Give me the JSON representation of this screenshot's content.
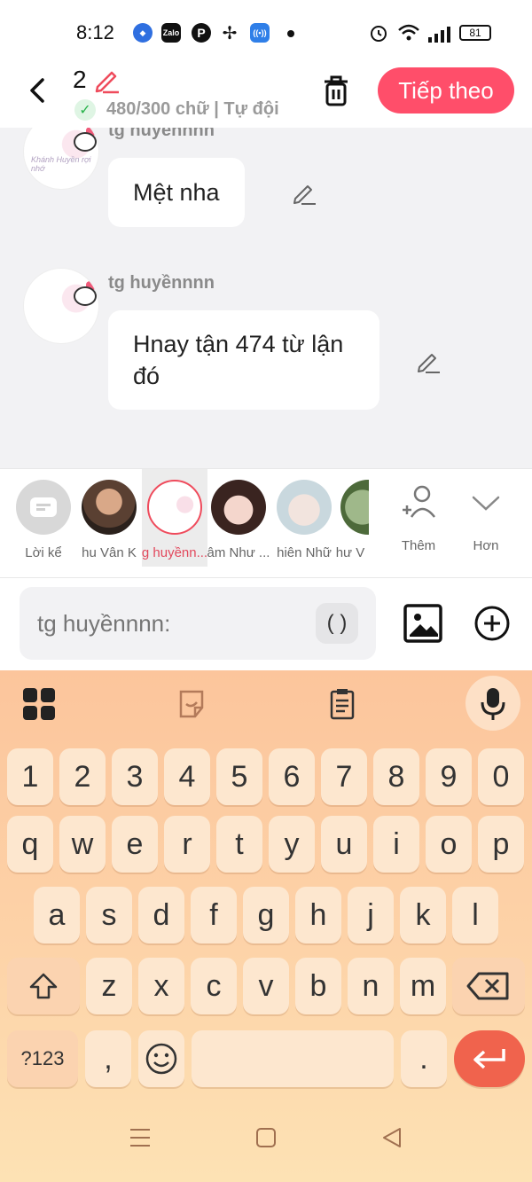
{
  "status": {
    "time": "8:12",
    "battery": "81",
    "app_icons": [
      "browser-icon",
      "zalo-icon",
      "pinterest-icon",
      "pinwheel-icon",
      "hotspot-icon"
    ]
  },
  "header": {
    "count": "2",
    "word_count": "480/300 chữ | Tự đội",
    "next_label": "Tiếp theo"
  },
  "messages": [
    {
      "author": "tg huyềnnnn",
      "text": "Mệt nha"
    },
    {
      "author": "tg huyềnnnn",
      "text": "Hnay tận 474 từ lận đó"
    }
  ],
  "avatar_script": "Khánh Huyền\nrợi nhớ",
  "characters": [
    {
      "label": "Lời kể"
    },
    {
      "label": "hu Vân K"
    },
    {
      "label": "g huyềnn..."
    },
    {
      "label": "âm Như ..."
    },
    {
      "label": "hiên Nhữ"
    },
    {
      "label": "hư V"
    }
  ],
  "side": {
    "add_label": "Thêm",
    "more_label": "Hơn"
  },
  "composer": {
    "placeholder": "tg huyềnnnn:",
    "paren": "( )"
  },
  "keyboard": {
    "row_numbers": [
      "1",
      "2",
      "3",
      "4",
      "5",
      "6",
      "7",
      "8",
      "9",
      "0"
    ],
    "row_top": [
      "q",
      "w",
      "e",
      "r",
      "t",
      "y",
      "u",
      "i",
      "o",
      "p"
    ],
    "row_mid": [
      "a",
      "s",
      "d",
      "f",
      "g",
      "h",
      "j",
      "k",
      "l"
    ],
    "row_bot": [
      "z",
      "x",
      "c",
      "v",
      "b",
      "n",
      "m"
    ],
    "sym": "?123",
    "comma": ",",
    "period": "."
  },
  "colors": {
    "accent": "#ff4e6a",
    "selected": "#ef4b5c",
    "return": "#f0634d"
  }
}
